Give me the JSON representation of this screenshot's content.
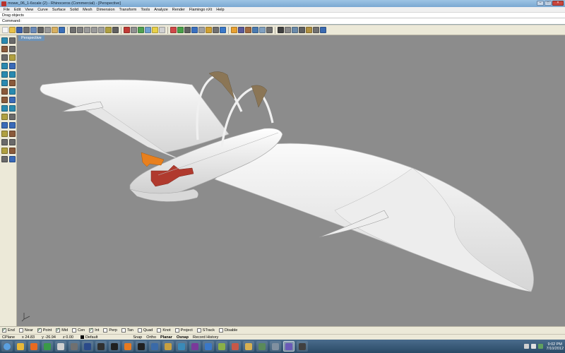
{
  "window": {
    "title": "mowe_06_1-6scale (2) - Rhinoceros (Commercial) - [Perspective]",
    "min_label": "–",
    "max_label": "□",
    "close_label": "×"
  },
  "menu": [
    "File",
    "Edit",
    "View",
    "Curve",
    "Surface",
    "Solid",
    "Mesh",
    "Dimension",
    "Transform",
    "Tools",
    "Analyze",
    "Render",
    "Flamingo nXt",
    "Help"
  ],
  "command": {
    "history": "Drag objects",
    "prompt": "Command:",
    "value": ""
  },
  "toolbar_icons": [
    {
      "name": "new-icon",
      "color": "#f4f4f4"
    },
    {
      "name": "open-icon",
      "color": "#e8c048"
    },
    {
      "name": "save-icon",
      "color": "#3a5fa8"
    },
    {
      "name": "print-icon",
      "color": "#707070"
    },
    {
      "name": "import-icon",
      "color": "#6a8ab8"
    },
    {
      "name": "cut-icon",
      "color": "#606060"
    },
    {
      "name": "copy-icon",
      "color": "#9a9a9a"
    },
    {
      "name": "paste-icon",
      "color": "#d8b060"
    },
    {
      "name": "undo-icon",
      "color": "#3a6fb8"
    },
    {
      "name": "pan-icon",
      "color": "#707070"
    },
    {
      "name": "rotate-view-icon",
      "color": "#808080"
    },
    {
      "name": "zoom-icon",
      "color": "#9a9a9a"
    },
    {
      "name": "zoom-window-icon",
      "color": "#9a9a9a"
    },
    {
      "name": "zoom-extents-icon",
      "color": "#a0a0a0"
    },
    {
      "name": "zoom-selected-icon",
      "color": "#b0a040"
    },
    {
      "name": "select-all-icon",
      "color": "#606060"
    },
    {
      "name": "flat-view-icon",
      "color": "#c03a34"
    },
    {
      "name": "grid-icon",
      "color": "#909090"
    },
    {
      "name": "cplane-icon",
      "color": "#50a050"
    },
    {
      "name": "layer-icon",
      "color": "#70a0d0"
    },
    {
      "name": "light-icon",
      "color": "#e8d048"
    },
    {
      "name": "properties-icon",
      "color": "#d0d0d0"
    },
    {
      "name": "render-icon",
      "color": "#d04848"
    },
    {
      "name": "material-icon",
      "color": "#48a048"
    },
    {
      "name": "shade-icon",
      "color": "#606060"
    },
    {
      "name": "rendered-view-icon",
      "color": "#3a70c0"
    },
    {
      "name": "ghosted-icon",
      "color": "#a0a0a0"
    },
    {
      "name": "snapshot-icon",
      "color": "#d0a030"
    },
    {
      "name": "camera-icon",
      "color": "#707070"
    },
    {
      "name": "environment-icon",
      "color": "#3a78c8"
    },
    {
      "name": "sun-icon",
      "color": "#e8a030"
    },
    {
      "name": "mesh-icon",
      "color": "#5a5a9a"
    },
    {
      "name": "texture-icon",
      "color": "#a06a40"
    },
    {
      "name": "decal-icon",
      "color": "#4a7ab0"
    },
    {
      "name": "turntable-icon",
      "color": "#80a0c0"
    },
    {
      "name": "dimension-icon",
      "color": "#707070"
    },
    {
      "name": "text-icon",
      "color": "#404040"
    },
    {
      "name": "group-icon",
      "color": "#8a8a8a"
    },
    {
      "name": "block-icon",
      "color": "#6a8aaa"
    },
    {
      "name": "hide-icon",
      "color": "#606060"
    },
    {
      "name": "lock-icon",
      "color": "#b09040"
    },
    {
      "name": "options-icon",
      "color": "#707070"
    },
    {
      "name": "help-icon",
      "color": "#3a6ab0"
    }
  ],
  "left_tools": [
    [
      "select-arrow-icon",
      "point-icon"
    ],
    [
      "polyline-icon",
      "curve-icon"
    ],
    [
      "circle-icon",
      "arc-icon"
    ],
    [
      "ellipse-icon",
      "rectangle-icon"
    ],
    [
      "polygon-icon",
      "text-object-icon"
    ],
    [
      "surface-icon",
      "extrude-icon"
    ],
    [
      "box-icon",
      "sphere-icon"
    ],
    [
      "cylinder-icon",
      "cone-icon"
    ],
    [
      "boolean-icon",
      "fillet-icon"
    ],
    [
      "transform-icon",
      "array-icon"
    ],
    [
      "split-icon",
      "trim-icon"
    ],
    [
      "join-icon",
      "explode-icon"
    ],
    [
      "mirror-icon",
      "scale-icon"
    ],
    [
      "dimension-tool-icon",
      "analyze-icon"
    ],
    [
      "render-tool-icon",
      "grid-tool-icon"
    ]
  ],
  "viewport": {
    "label": "Perspective"
  },
  "osnaps": [
    {
      "label": "End",
      "checked": true
    },
    {
      "label": "Near",
      "checked": false
    },
    {
      "label": "Point",
      "checked": true
    },
    {
      "label": "Mid",
      "checked": true
    },
    {
      "label": "Cen",
      "checked": false
    },
    {
      "label": "Int",
      "checked": true
    },
    {
      "label": "Perp",
      "checked": false
    },
    {
      "label": "Tan",
      "checked": false
    },
    {
      "label": "Quad",
      "checked": false
    },
    {
      "label": "Knot",
      "checked": false
    },
    {
      "label": "Project",
      "checked": false
    },
    {
      "label": "STrack",
      "checked": false
    },
    {
      "label": "Disable",
      "checked": false
    }
  ],
  "status": {
    "cplane": "CPlane",
    "x": "x 24.83",
    "y": "y -26.94",
    "z": "z 0.00",
    "layer": "Default",
    "toggles": [
      "Snap",
      "Ortho",
      "Planar",
      "Osnap",
      "Record History"
    ]
  },
  "taskbar": {
    "apps": [
      {
        "name": "start-orb-icon",
        "color": "#5aa0e0"
      },
      {
        "name": "explorer-icon",
        "color": "#e8b838"
      },
      {
        "name": "firefox-icon",
        "color": "#e86a20"
      },
      {
        "name": "chrome-icon",
        "color": "#3a9a48"
      },
      {
        "name": "media-icon",
        "color": "#d0d0d0"
      },
      {
        "name": "rhino-icon",
        "color": "#707070"
      },
      {
        "name": "photoshop-icon",
        "color": "#2a4a8a"
      },
      {
        "name": "unity-icon",
        "color": "#303030"
      },
      {
        "name": "inkscape-icon",
        "color": "#202020"
      },
      {
        "name": "blender-icon",
        "color": "#e87a20"
      },
      {
        "name": "terminal-icon",
        "color": "#202020"
      },
      {
        "name": "viewer-icon",
        "color": "#3a6aa8"
      },
      {
        "name": "folder-icon",
        "color": "#c8a040"
      },
      {
        "name": "chat-icon",
        "color": "#3a8ab8"
      },
      {
        "name": "music-icon",
        "color": "#7a3a9a"
      },
      {
        "name": "document-icon",
        "color": "#3a78c8"
      },
      {
        "name": "image-icon",
        "color": "#8ab048"
      },
      {
        "name": "paint-icon",
        "color": "#c85848"
      },
      {
        "name": "mail-icon",
        "color": "#d8b050"
      },
      {
        "name": "calendar-icon",
        "color": "#5a8a5a"
      },
      {
        "name": "settings-icon",
        "color": "#8090a0"
      },
      {
        "name": "eye-icon",
        "color": "#6a5ab8"
      },
      {
        "name": "camera-app-icon",
        "color": "#404040"
      }
    ],
    "active_index": 21,
    "clock_time": "9:02 PM",
    "clock_date": "7/10/2012"
  }
}
